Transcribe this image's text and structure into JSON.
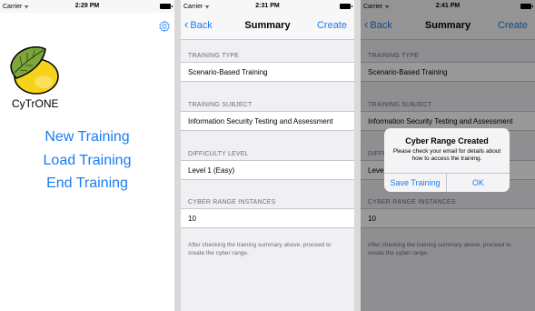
{
  "status": {
    "carrier": "Carrier",
    "wifi": "ᯤ",
    "time1": "2:29 PM",
    "time2": "2:31 PM",
    "time3": "2:41 PM"
  },
  "home": {
    "logo_label": "CyTrONE",
    "buttons": [
      "New Training",
      "Load Training",
      "End Training"
    ]
  },
  "summary": {
    "back_label": "Back",
    "title": "Summary",
    "create_label": "Create",
    "sections": [
      {
        "header": "TRAINING TYPE",
        "value": "Scenario-Based Training"
      },
      {
        "header": "TRAINING SUBJECT",
        "value": "Information Security Testing and Assessment"
      },
      {
        "header": "DIFFICULTY LEVEL",
        "value": "Level 1 (Easy)"
      },
      {
        "header": "CYBER RANGE INSTANCES",
        "value": "10"
      }
    ],
    "note": "After checking the training summary above, proceed to create the cyber range."
  },
  "alert": {
    "title": "Cyber Range Created",
    "message": "Please check your email for details about how to access the training.",
    "save_label": "Save Training",
    "ok_label": "OK"
  },
  "colors": {
    "accent": "#1a7cf4",
    "grouped_background": "#efeff4",
    "secondary_text": "#6d6d72"
  }
}
